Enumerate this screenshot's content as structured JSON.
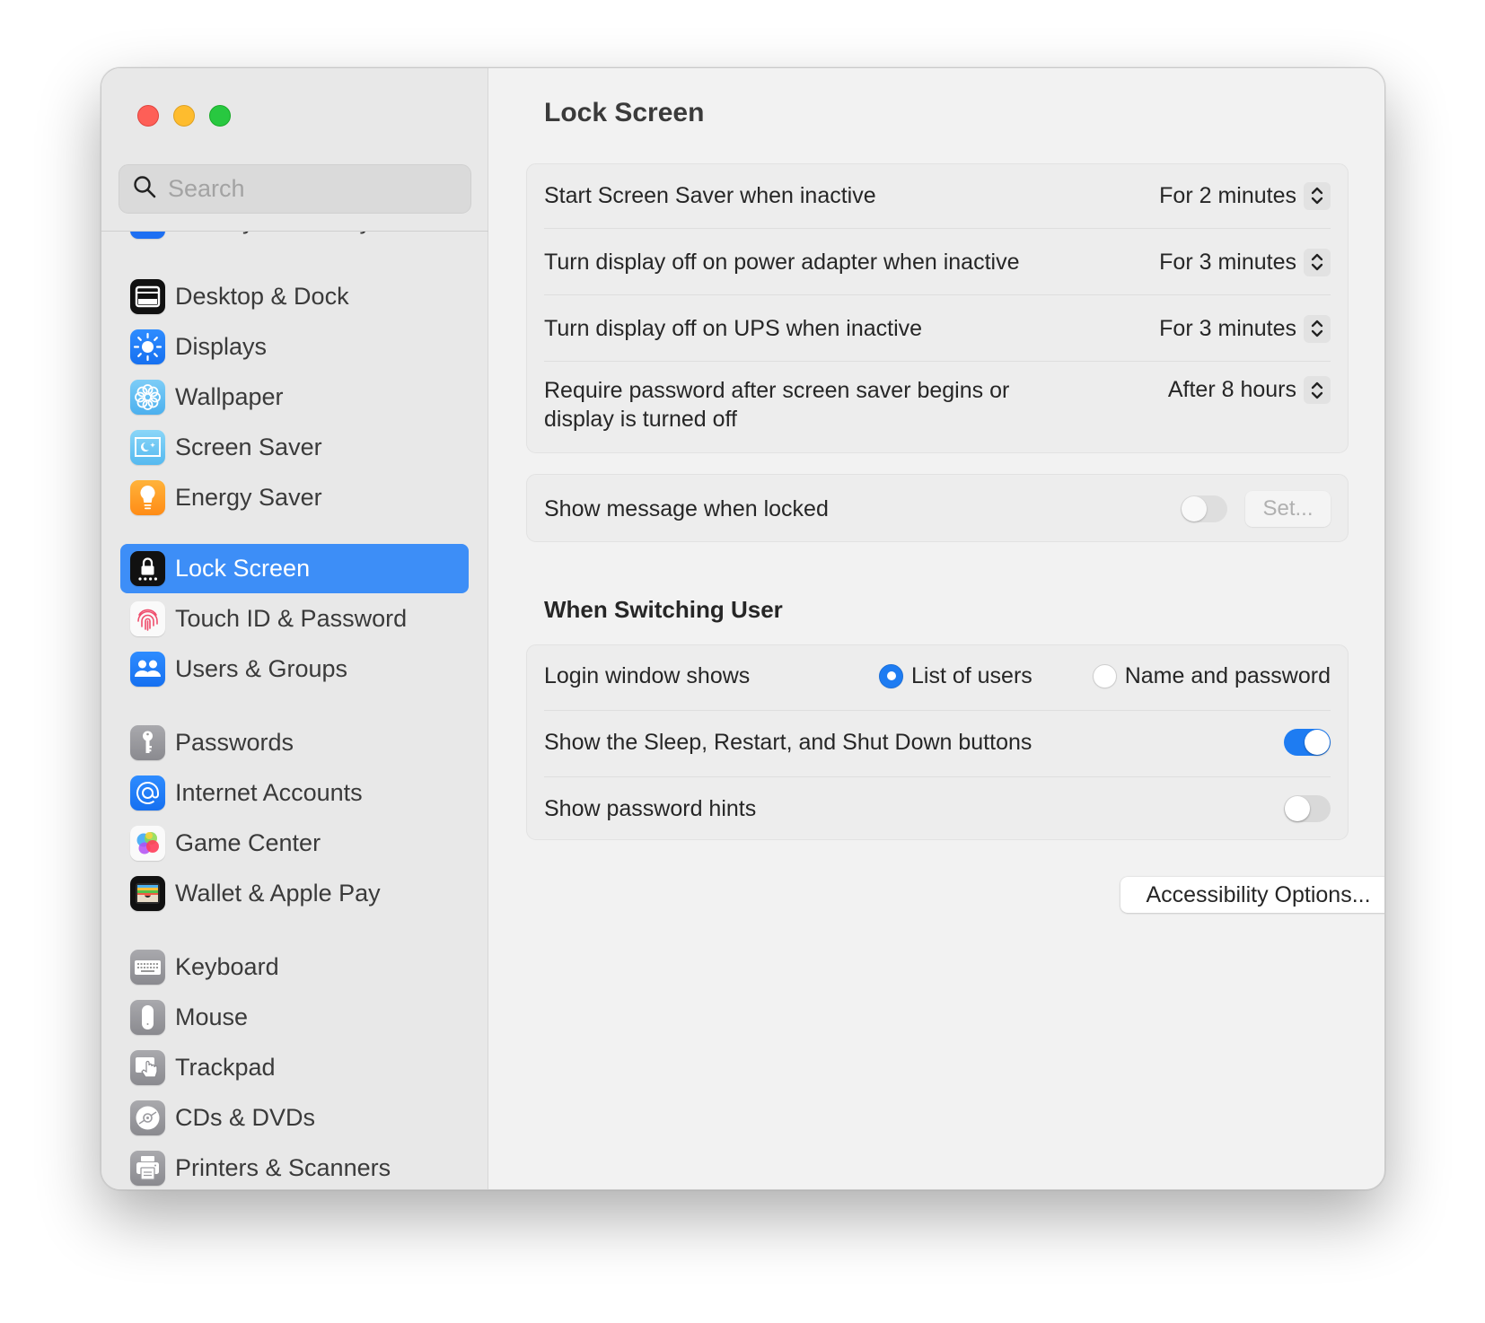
{
  "window": {
    "traffic_lights": [
      "close",
      "minimize",
      "zoom"
    ],
    "colors": {
      "close": "#fe5f57",
      "minimize": "#febc2e",
      "zoom": "#28c840",
      "accent": "#1e7cf2",
      "selection": "#3d8ef7"
    }
  },
  "sidebar": {
    "search": {
      "placeholder": "Search",
      "value": ""
    },
    "partial_item": {
      "label": "Privacy & Security",
      "icon": "hand-icon"
    },
    "items": [
      {
        "label": "Desktop & Dock",
        "icon": "dock-icon"
      },
      {
        "label": "Displays",
        "icon": "sun-icon"
      },
      {
        "label": "Wallpaper",
        "icon": "flower-icon"
      },
      {
        "label": "Screen Saver",
        "icon": "screensaver-icon"
      },
      {
        "label": "Energy Saver",
        "icon": "lightbulb-icon"
      },
      {
        "label": "Lock Screen",
        "icon": "lock-icon",
        "selected": true
      },
      {
        "label": "Touch ID & Password",
        "icon": "fingerprint-icon"
      },
      {
        "label": "Users & Groups",
        "icon": "users-icon"
      },
      {
        "label": "Passwords",
        "icon": "key-icon"
      },
      {
        "label": "Internet Accounts",
        "icon": "at-icon"
      },
      {
        "label": "Game Center",
        "icon": "game-center-icon"
      },
      {
        "label": "Wallet & Apple Pay",
        "icon": "wallet-icon"
      },
      {
        "label": "Keyboard",
        "icon": "keyboard-icon"
      },
      {
        "label": "Mouse",
        "icon": "mouse-icon"
      },
      {
        "label": "Trackpad",
        "icon": "trackpad-icon"
      },
      {
        "label": "CDs & DVDs",
        "icon": "disc-icon"
      },
      {
        "label": "Printers & Scanners",
        "icon": "printer-icon"
      }
    ]
  },
  "main": {
    "title": "Lock Screen",
    "inactivity_group": [
      {
        "label": "Start Screen Saver when inactive",
        "value": "For 2 minutes"
      },
      {
        "label": "Turn display off on power adapter when inactive",
        "value": "For 3 minutes"
      },
      {
        "label": "Turn display off on UPS when inactive",
        "value": "For 3 minutes"
      },
      {
        "label": "Require password after screen saver begins or display is turned off",
        "value": "After 8 hours"
      }
    ],
    "message_group": {
      "label": "Show message when locked",
      "toggle_on": false,
      "set_button": "Set..."
    },
    "switching_section": {
      "title": "When Switching User",
      "login_window": {
        "label": "Login window shows",
        "options": [
          {
            "label": "List of users",
            "checked": true
          },
          {
            "label": "Name and password",
            "checked": false
          }
        ]
      },
      "sleep_buttons": {
        "label": "Show the Sleep, Restart, and Shut Down buttons",
        "toggle_on": true
      },
      "password_hints": {
        "label": "Show password hints",
        "toggle_on": false
      }
    },
    "accessibility_button": "Accessibility Options...",
    "help_button": "?"
  }
}
